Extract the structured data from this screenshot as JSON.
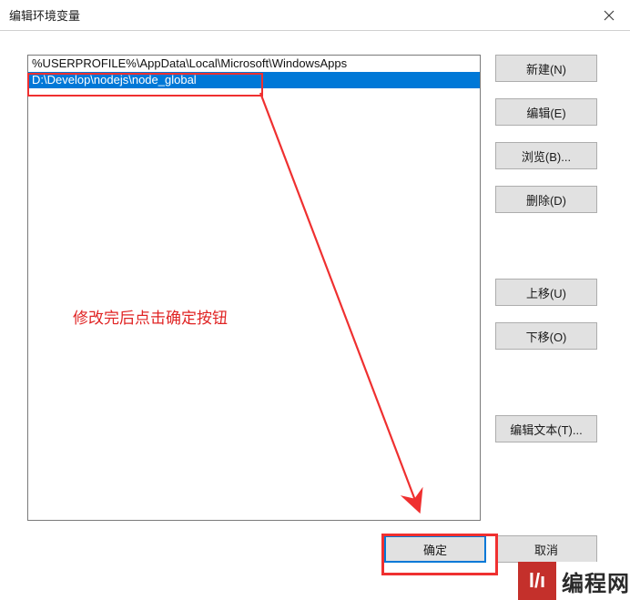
{
  "window": {
    "title": "编辑环境变量"
  },
  "list": {
    "items": [
      {
        "text": "%USERPROFILE%\\AppData\\Local\\Microsoft\\WindowsApps",
        "selected": false
      },
      {
        "text": "D:\\Develop\\nodejs\\node_global",
        "selected": true
      }
    ]
  },
  "buttons": {
    "new": "新建(N)",
    "edit": "编辑(E)",
    "browse": "浏览(B)...",
    "delete": "删除(D)",
    "moveUp": "上移(U)",
    "moveDown": "下移(O)",
    "editText": "编辑文本(T)...",
    "ok": "确定",
    "cancel": "取消"
  },
  "annotation": {
    "hint": "修改完后点击确定按钮"
  },
  "watermark": {
    "logo": "l/ı",
    "text": "编程网"
  }
}
